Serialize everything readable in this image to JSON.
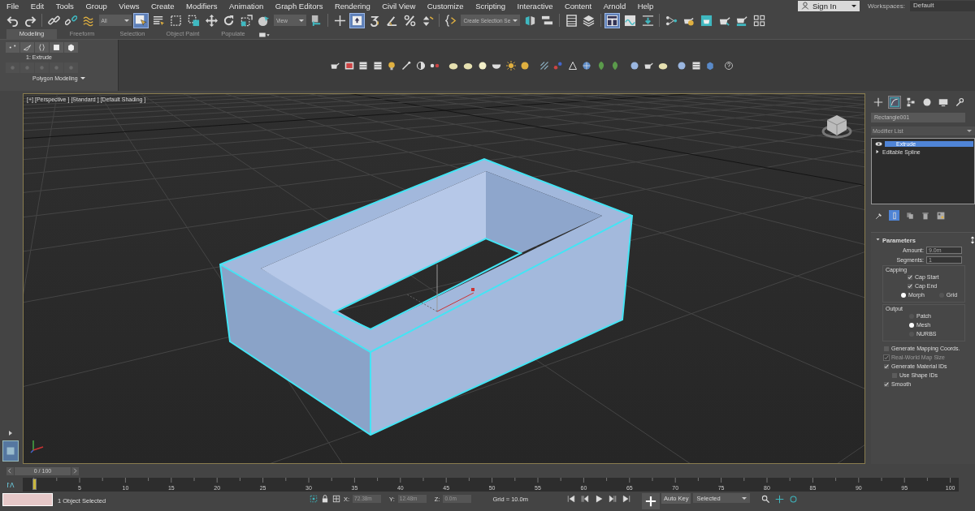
{
  "menu_bar": {
    "items": [
      "File",
      "Edit",
      "Tools",
      "Group",
      "Views",
      "Create",
      "Modifiers",
      "Animation",
      "Graph Editors",
      "Rendering",
      "Civil View",
      "Customize",
      "Scripting",
      "Interactive",
      "Content",
      "Arnold",
      "Help"
    ],
    "sign_in": "Sign In",
    "workspaces_label": "Workspaces:",
    "workspace": "Default"
  },
  "main_toolbar": {
    "items": [
      {
        "kind": "undo",
        "active": false
      },
      {
        "kind": "redo",
        "active": false
      },
      {
        "kind": "separator"
      },
      {
        "kind": "link",
        "active": false
      },
      {
        "kind": "unlink",
        "active": false
      },
      {
        "kind": "bind",
        "active": false
      },
      {
        "kind": "dropdown",
        "value": "All"
      },
      {
        "kind": "select",
        "active": true
      },
      {
        "kind": "select_name",
        "active": false
      },
      {
        "kind": "region",
        "active": false
      },
      {
        "kind": "crossing",
        "active": false
      },
      {
        "kind": "move",
        "active": false
      },
      {
        "kind": "rotate",
        "active": false
      },
      {
        "kind": "scale",
        "active": false
      },
      {
        "kind": "placement",
        "active": false
      },
      {
        "kind": "dropdown",
        "value": "View"
      },
      {
        "kind": "pivot",
        "active": false
      },
      {
        "kind": "separator"
      },
      {
        "kind": "manipulate",
        "active": false
      },
      {
        "kind": "keyboard",
        "active": true
      },
      {
        "kind": "snap",
        "active": false
      },
      {
        "kind": "angle",
        "active": false
      },
      {
        "kind": "percent",
        "active": false
      },
      {
        "kind": "spinner",
        "active": false
      },
      {
        "kind": "separator"
      },
      {
        "kind": "named_edit",
        "active": false
      },
      {
        "kind": "dropdown",
        "value": "Create Selection Se"
      },
      {
        "kind": "mirror",
        "active": false
      },
      {
        "kind": "align",
        "active": false
      },
      {
        "kind": "separator"
      },
      {
        "kind": "explorer",
        "active": false
      },
      {
        "kind": "layers",
        "active": false
      },
      {
        "kind": "separator"
      },
      {
        "kind": "ribbon",
        "active": true
      },
      {
        "kind": "curve",
        "active": false
      },
      {
        "kind": "dope",
        "active": false
      },
      {
        "kind": "separator"
      },
      {
        "kind": "schematic",
        "active": false
      },
      {
        "kind": "material",
        "active": false
      },
      {
        "kind": "render_setup",
        "active": false
      },
      {
        "kind": "render",
        "active": false
      },
      {
        "kind": "render_frame",
        "active": false
      },
      {
        "kind": "layout",
        "active": false
      }
    ]
  },
  "ribbon": {
    "tabs": [
      {
        "label": "Modeling",
        "selected": true
      },
      {
        "label": "Freeform",
        "selected": false
      },
      {
        "label": "Selection",
        "selected": false
      },
      {
        "label": "Object Paint",
        "selected": false
      },
      {
        "label": "Populate",
        "selected": false
      }
    ],
    "panel_label": "1: Extrude",
    "panel_title": "Polygon Modeling"
  },
  "viewport": {
    "labels": [
      "[+]",
      "[Perspective ]",
      "[Standard ]",
      "[Default Shading ]"
    ]
  },
  "command_panel": {
    "tabs": [
      {
        "kind": "create",
        "selected": false
      },
      {
        "kind": "modify",
        "selected": true
      },
      {
        "kind": "hierarchy",
        "selected": false
      },
      {
        "kind": "motion",
        "selected": false
      },
      {
        "kind": "display",
        "selected": false
      },
      {
        "kind": "utilities",
        "selected": false
      }
    ],
    "object_name": "Rectangle001",
    "modifier_list": "Modifier List",
    "stack": [
      {
        "kind": "modifier",
        "label": "Extrude",
        "selected": true
      },
      {
        "kind": "base",
        "label": "Editable Spline",
        "selected": false
      }
    ],
    "stack_tools": [
      {
        "kind": "pin",
        "active": false
      },
      {
        "kind": "end_result",
        "active": true
      },
      {
        "kind": "unique",
        "active": false
      },
      {
        "kind": "remove",
        "active": false
      },
      {
        "kind": "configure",
        "active": false
      }
    ],
    "rollout": {
      "title": "Parameters",
      "expanded": true,
      "amount_label": "Amount:",
      "amount": "9.0m",
      "segments_label": "Segments:",
      "segments": "1",
      "groups": [
        {
          "title": "Capping",
          "options": [
            {
              "kind": "checkbox",
              "label": "Cap Start",
              "checked": true
            },
            {
              "kind": "checkbox",
              "label": "Cap End",
              "checked": true
            },
            {
              "kind": "radio_row",
              "choices": [
                {
                  "label": "Morph",
                  "selected": true
                },
                {
                  "label": "Grid",
                  "selected": false
                }
              ]
            }
          ]
        },
        {
          "title": "Output",
          "options": [
            {
              "kind": "radio_column",
              "choices": [
                {
                  "label": "Patch",
                  "selected": false
                },
                {
                  "label": "Mesh",
                  "selected": true
                },
                {
                  "label": "NURBS",
                  "selected": false
                }
              ]
            }
          ]
        }
      ],
      "options": [
        {
          "label": "Generate Mapping Coords.",
          "checked": false,
          "disabled": false
        },
        {
          "label": "Real-World Map Size",
          "checked": true,
          "disabled": true
        },
        {
          "label": "Generate Material IDs",
          "checked": true,
          "disabled": false,
          "children": [
            {
              "label": "Use Shape IDs",
              "checked": false,
              "disabled": false
            }
          ]
        },
        {
          "label": "Smooth",
          "checked": true,
          "disabled": false
        }
      ]
    }
  },
  "time_slider": {
    "position": "0 / 100",
    "level": 0,
    "ticks": [
      "5",
      "10",
      "15",
      "20",
      "25",
      "30",
      "35",
      "40",
      "45",
      "50",
      "55",
      "60",
      "65",
      "70",
      "75",
      "80",
      "85",
      "90",
      "95",
      "100"
    ]
  },
  "status_bar": {
    "message": "1 Object Selected",
    "x_label": "X:",
    "x": "72.38m",
    "y_label": "Y:",
    "y": "12.48m",
    "z_label": "Z:",
    "z": "0.0m",
    "grid": "Grid = 10.0m",
    "auto_key": "Auto Key",
    "key_filter": "Selected"
  }
}
